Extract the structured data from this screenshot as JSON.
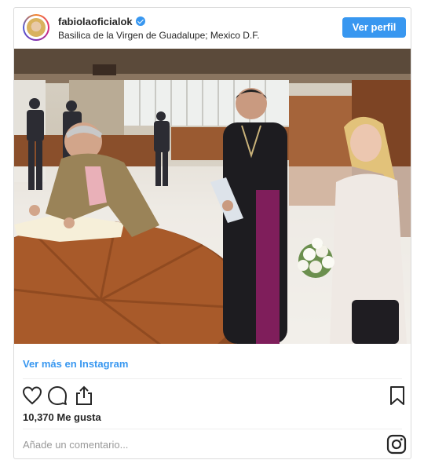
{
  "post": {
    "username": "fabiolaoficialok",
    "location": "Basilica de la Virgen de Guadalupe; Mexico D.F.",
    "follow_button_label": "Ver perfil",
    "view_more_label": "Ver más en Instagram",
    "likes_text": "10,370 Me gusta",
    "comment_placeholder": "Añade un comentario..."
  },
  "icons": {
    "verified": "verified-badge-icon",
    "like": "heart-icon",
    "comment": "comment-bubble-icon",
    "share": "share-icon",
    "save": "bookmark-icon",
    "instagram": "instagram-icon"
  },
  "colors": {
    "accent": "#3897f0",
    "text": "#262626",
    "muted": "#999999",
    "border": "#dbdbdb"
  }
}
